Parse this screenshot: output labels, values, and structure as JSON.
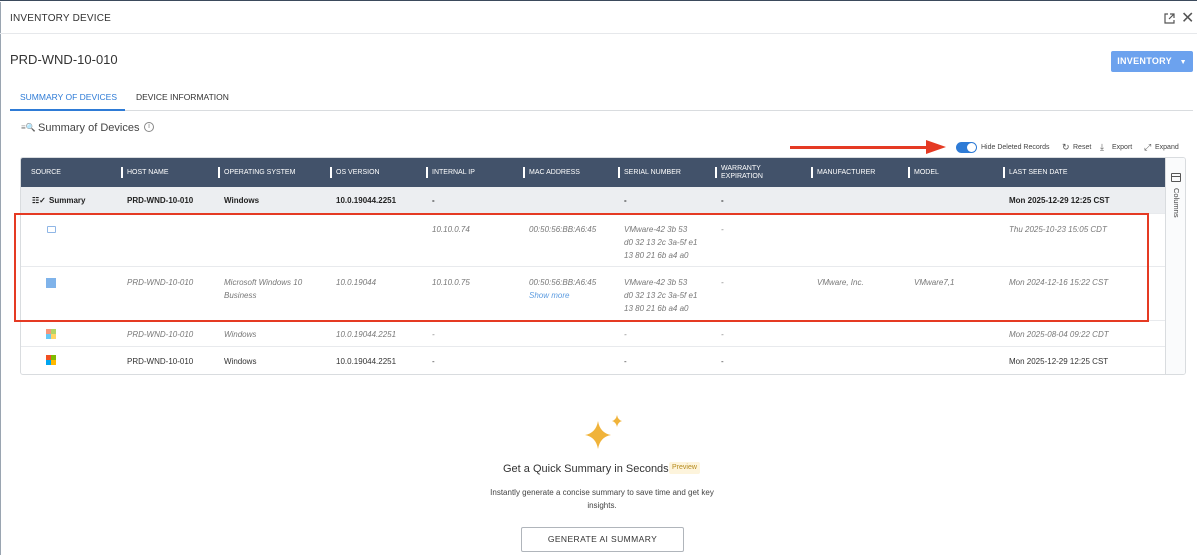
{
  "window": {
    "title": "INVENTORY DEVICE"
  },
  "device": {
    "name": "PRD-WND-10-010"
  },
  "inventory_button": {
    "label": "INVENTORY"
  },
  "tabs": [
    {
      "label": "SUMMARY OF DEVICES",
      "active": true
    },
    {
      "label": "DEVICE INFORMATION",
      "active": false
    }
  ],
  "section": {
    "title": "Summary of Devices"
  },
  "toolbar": {
    "hide_deleted_label": "Hide Deleted Records",
    "hide_deleted_on": true,
    "reset_label": "Reset",
    "export_label": "Export",
    "expand_label": "Expand"
  },
  "table": {
    "columns": [
      "SOURCE",
      "HOST NAME",
      "OPERATING SYSTEM",
      "OS VERSION",
      "INTERNAL IP",
      "MAC ADDRESS",
      "SERIAL NUMBER",
      "WARRANTY EXPIRATION",
      "MANUFACTURER",
      "MODEL",
      "LAST SEEN DATE"
    ],
    "summary_row": {
      "source": "Summary",
      "host": "PRD-WND-10-010",
      "os": "Windows",
      "os_version": "10.0.19044.2251",
      "ip": "-",
      "mac": "",
      "serial": "-",
      "warranty": "-",
      "manufacturer": "",
      "model": "",
      "last_seen": "Mon 2025-12-29 12:25 CST"
    },
    "rows": [
      {
        "source_icon": "desktop-agent-icon",
        "host": "",
        "os": "",
        "os_version": "",
        "ip": "10.10.0.74",
        "mac": "00:50:56:BB:A6:45",
        "serial_l1": "VMware-42 3b 53",
        "serial_l2": "d0 32 13 2c 3a-5f e1",
        "serial_l3": "13 80 21 6b a4 a0",
        "warranty": "-",
        "manufacturer": "",
        "model": "",
        "last_seen": "Thu 2025-10-23 15:05 CDT"
      },
      {
        "source_icon": "windows-blue-icon",
        "host": "PRD-WND-10-010",
        "os_l1": "Microsoft Windows 10",
        "os_l2": "Business",
        "os_version": "10.0.19044",
        "ip": "10.10.0.75",
        "mac": "00:50:56:BB:A6:45",
        "show_more": "Show more",
        "serial_l1": "VMware-42 3b 53",
        "serial_l2": "d0 32 13 2c 3a-5f e1",
        "serial_l3": "13 80 21 6b a4 a0",
        "warranty": "-",
        "manufacturer": "VMware, Inc.",
        "model": "VMware7,1",
        "last_seen": "Mon 2024-12-16 15:22 CST"
      },
      {
        "source_icon": "windows-color-icon",
        "host": "PRD-WND-10-010",
        "os": "Windows",
        "os_version": "10.0.19044.2251",
        "ip": "-",
        "serial": "-",
        "warranty": "-",
        "last_seen": "Mon 2025-08-04 09:22 CDT"
      },
      {
        "source_icon": "windows-color-icon",
        "host": "PRD-WND-10-010",
        "os": "Windows",
        "os_version": "10.0.19044.2251",
        "ip": "-",
        "serial": "-",
        "warranty": "-",
        "last_seen": "Mon 2025-12-29 12:25 CST"
      }
    ],
    "side_panel_label": "Columns"
  },
  "ai_summary": {
    "title": "Get a Quick Summary in Seconds",
    "badge": "Preview",
    "description": "Instantly generate a concise summary to save time and get key insights.",
    "button": "GENERATE AI SUMMARY"
  },
  "colors": {
    "accent": "#2e7bd6",
    "header_bg": "#42526a",
    "annotation": "#e53a23",
    "button_blue": "#6ca2ee"
  }
}
